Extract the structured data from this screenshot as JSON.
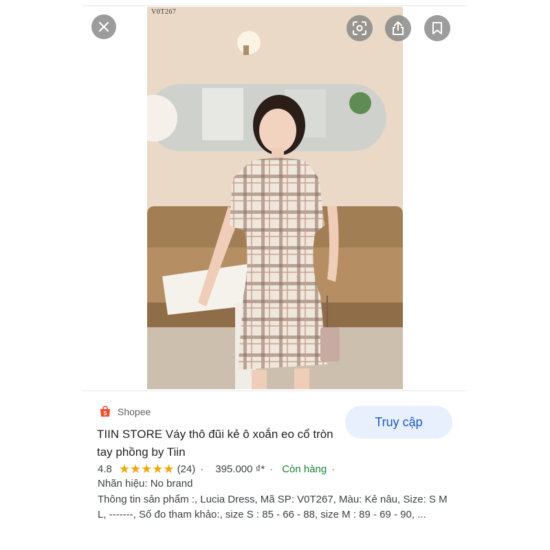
{
  "photo": {
    "code": "V0T267"
  },
  "overlay": {
    "close_icon": "close-icon",
    "lens_icon": "lens-icon",
    "share_icon": "share-icon",
    "bookmark_icon": "bookmark-icon"
  },
  "source": {
    "name": "Shopee",
    "icon": "shopee-bag-icon",
    "icon_color": "#ee4d2d"
  },
  "visit_button": {
    "label": "Truy cập"
  },
  "product": {
    "title": "TIIN STORE Váy thô đũi kẻ ô xoắn eo cổ tròn tay phồng by Tiin",
    "rating": "4.8",
    "rating_value": 4.8,
    "review_count": "(24)",
    "price": "395.000 ₫*",
    "stock": "Còn hàng",
    "brand": "Nhãn hiệu: No brand",
    "description": "Thông tin sản phẩm :, Lucia Dress, Mã SP: V0T267, Màu: Kẻ nâu, Size: S M L, -------, Số đo tham khảo:, size S : 85 - 66 - 88, size M : 89 - 69 - 90, ..."
  },
  "colors": {
    "accent_blue": "#1a57c4",
    "star": "#f2a50c",
    "in_stock": "#188038"
  }
}
